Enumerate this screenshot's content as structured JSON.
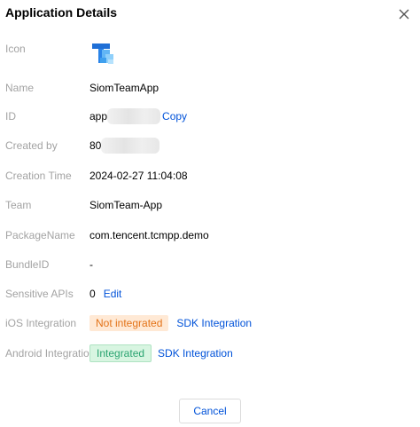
{
  "dialog": {
    "title": "Application Details",
    "close_icon": "close-icon"
  },
  "fields": {
    "icon_label": "Icon",
    "app_icon": "app-logo-icon",
    "name_label": "Name",
    "name_value": "SiomTeamApp",
    "id_label": "ID",
    "id_value_prefix": "app",
    "id_copy": "Copy",
    "created_by_label": "Created by",
    "created_by_prefix": "80",
    "creation_time_label": "Creation Time",
    "creation_time_value": "2024-02-27 11:04:08",
    "team_label": "Team",
    "team_value": "SiomTeam-App",
    "package_label": "PackageName",
    "package_value": "com.tencent.tcmpp.demo",
    "bundle_label": "BundleID",
    "bundle_value": "-",
    "sensitive_label": "Sensitive APIs",
    "sensitive_value": "0",
    "sensitive_edit": "Edit",
    "ios_label": "iOS Integration",
    "ios_status": "Not integrated",
    "ios_link": "SDK Integration",
    "android_label": "Android Integration",
    "android_status": "Integrated",
    "android_link": "SDK Integration"
  },
  "footer": {
    "cancel_label": "Cancel"
  },
  "colors": {
    "link": "#0052d9",
    "label": "#a3a3a3",
    "warn_bg": "#ffe9d5",
    "warn_text": "#e37318",
    "ok_bg": "#d8f5e1",
    "ok_text": "#2ba471"
  }
}
